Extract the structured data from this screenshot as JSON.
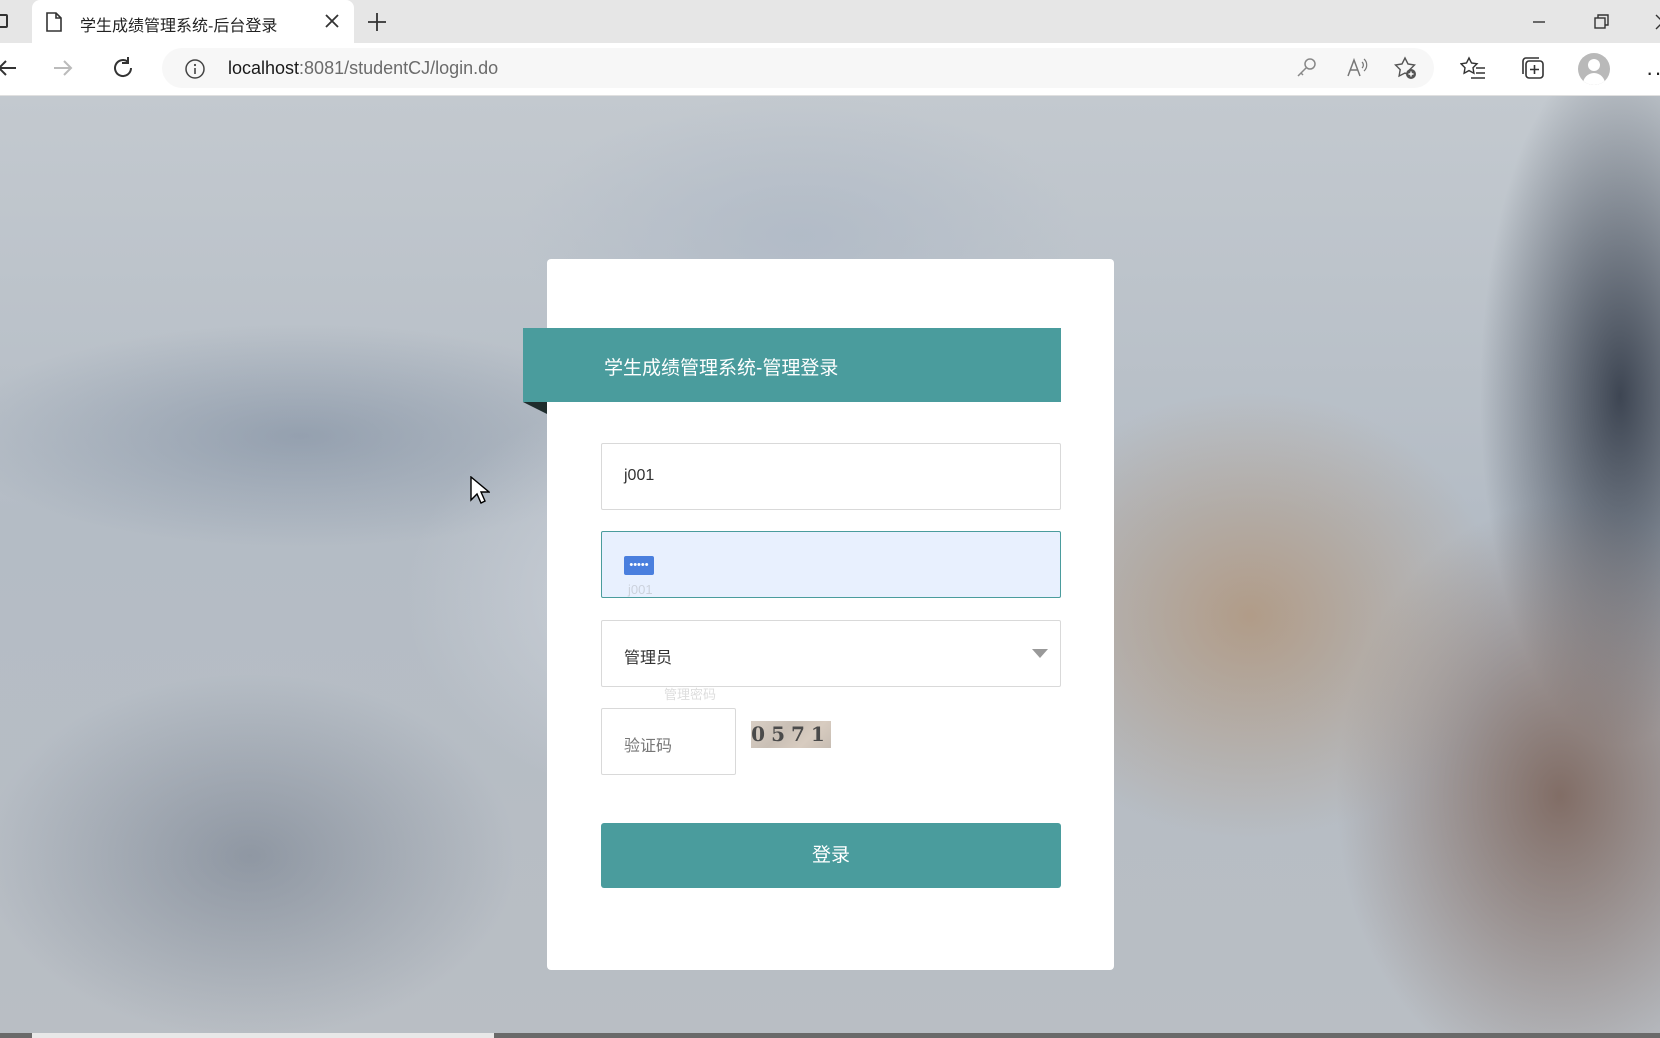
{
  "browser": {
    "tab_title": "学生成绩管理系统-后台登录",
    "url_host": "localhost",
    "url_path": ":8081/studentCJ/login.do"
  },
  "login": {
    "title": "学生成绩管理系统-管理登录",
    "username_value": "j001",
    "password_mask": "•••••",
    "role_selected": "管理员",
    "captcha_placeholder": "验证码",
    "captcha_code": "0571",
    "submit_label": "登录"
  },
  "autofill_ghost": {
    "line1": "j001",
    "line2": "j001",
    "line3": "管理密码"
  },
  "colors": {
    "accent": "#4a9c9d",
    "autofill_bg": "#e8f0fe",
    "selection": "#4a7fde"
  }
}
